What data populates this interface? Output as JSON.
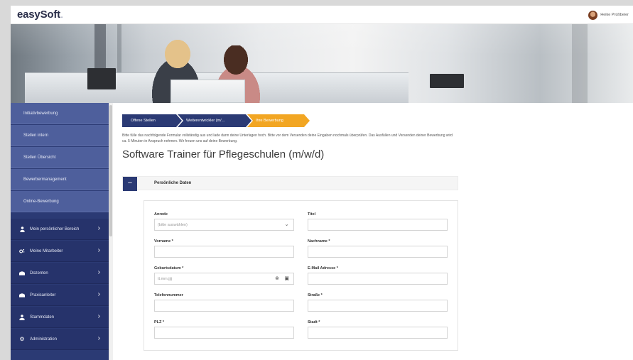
{
  "header": {
    "logo_text": "easySoft",
    "logo_dot": ".",
    "user_name": "Heike Prüßbeier"
  },
  "sidebar": {
    "items": [
      {
        "label": "Initiativbewerbung",
        "style": "light"
      },
      {
        "label": "Stellen intern",
        "style": "light"
      },
      {
        "label": "Stellen Übersicht",
        "style": "light"
      },
      {
        "label": "Bewerbermanagement",
        "style": "light"
      },
      {
        "label": "Online-Bewerbung",
        "style": "light"
      },
      {
        "label": "Mein persönlicher Bereich",
        "style": "dark",
        "icon": "person-icon"
      },
      {
        "label": "Meine Mitarbeiter",
        "style": "dark",
        "icon": "team-icon"
      },
      {
        "label": "Dozenten",
        "style": "dark",
        "icon": "lecturer-icon"
      },
      {
        "label": "Praxisanleiter",
        "style": "dark",
        "icon": "mentor-icon"
      },
      {
        "label": "Stammdaten",
        "style": "dark",
        "icon": "master-data-icon"
      },
      {
        "label": "Administration",
        "style": "dark",
        "icon": "gear-icon"
      }
    ]
  },
  "breadcrumb": {
    "items": [
      "Offene Stellen",
      "Weiterentwickler (m/...",
      "Ihre Bewerbung"
    ]
  },
  "intro_text": "Bitte fülle das nachfolgende Formular vollständig aus und lade dann deine Unterlagen hoch. Bitte vor dem Versenden deine Eingaben nochmals überprüfen. Das Ausfüllen und Versenden deiner Bewerbung wird ca. 5 Minuten in Anspruch nehmen. Wir freuen uns auf deine Bewerbung.",
  "page_title": "Software Trainer für Pflegeschulen (m/w/d)",
  "section": {
    "toggle_symbol": "−",
    "title": "Persönliche Daten"
  },
  "form": {
    "anrede": {
      "label": "Anrede",
      "value": "(bitte auswählen)"
    },
    "titel": {
      "label": "Titel",
      "value": ""
    },
    "vorname": {
      "label": "Vorname *",
      "value": ""
    },
    "nachname": {
      "label": "Nachname *",
      "value": ""
    },
    "geburtsdatum": {
      "label": "Geburtsdatum *",
      "placeholder": "tt.mm.jjjj"
    },
    "email": {
      "label": "E-Mail Adresse *",
      "value": ""
    },
    "telefon": {
      "label": "Telefonnummer",
      "value": ""
    },
    "strasse": {
      "label": "Straße *",
      "value": ""
    },
    "plz": {
      "label": "PLZ *",
      "value": ""
    },
    "stadt": {
      "label": "Stadt *",
      "value": ""
    }
  },
  "colors": {
    "sidebar": "#2b3a74",
    "sidebar_light": "#4e5f9c",
    "breadcrumb_active": "#f2a623"
  }
}
